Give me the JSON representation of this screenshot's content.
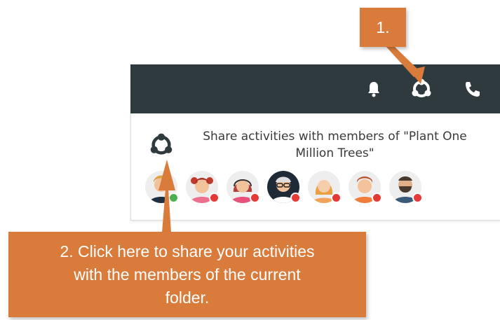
{
  "panel": {
    "share_text_line1": "Share activities with members of \"Plant One",
    "share_text_line2": "Million Trees\""
  },
  "topbar": {
    "icons": [
      "bell-icon",
      "share-activities-icon",
      "phone-icon"
    ]
  },
  "avatars": [
    {
      "status": "online"
    },
    {
      "status": "offline"
    },
    {
      "status": "offline"
    },
    {
      "status": "offline"
    },
    {
      "status": "offline"
    },
    {
      "status": "offline"
    },
    {
      "status": "offline"
    }
  ],
  "callouts": {
    "step1": "1.",
    "step2_line1": "2.  Click here to share your activities",
    "step2_line2": "with the members of the current",
    "step2_line3": "folder."
  },
  "colors": {
    "topbar": "#2f3a3f",
    "callout": "#d97b3b",
    "online": "#4caf50",
    "offline": "#e53935"
  }
}
